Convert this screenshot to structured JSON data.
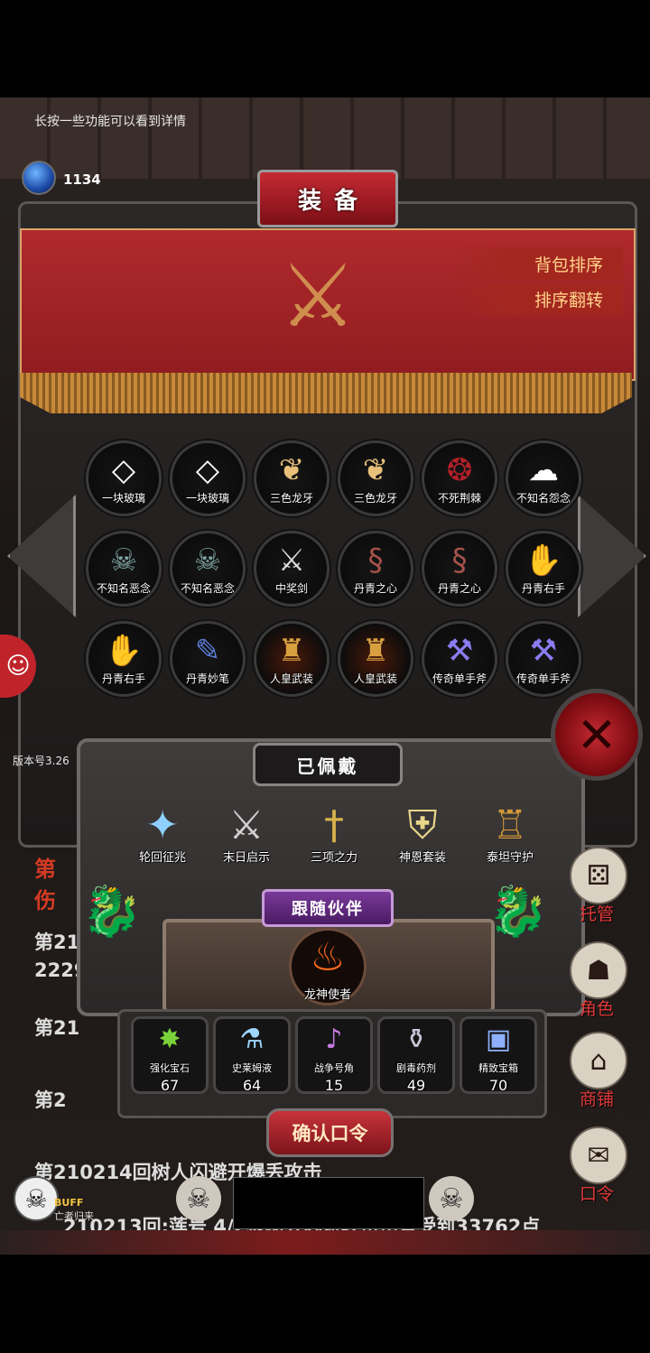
{
  "hint": "长按一些功能可以看到详情",
  "currency": {
    "icon": "gem-icon",
    "label": "宝石",
    "value": "1134"
  },
  "panel": {
    "title": "装备",
    "sort_bag": "背包排序",
    "sort_reverse": "排序翻转"
  },
  "inventory": [
    {
      "label": "一块玻璃",
      "icon": "glass-shard-icon"
    },
    {
      "label": "一块玻璃",
      "icon": "glass-shard-icon"
    },
    {
      "label": "三色龙牙",
      "icon": "dragon-fang-icon"
    },
    {
      "label": "三色龙牙",
      "icon": "dragon-fang-icon"
    },
    {
      "label": "不死荆棘",
      "icon": "thorn-ring-icon"
    },
    {
      "label": "不知名怨念",
      "icon": "ghost-icon"
    },
    {
      "label": "不知名恶念",
      "icon": "wraith-icon"
    },
    {
      "label": "不知名恶念",
      "icon": "wraith-icon"
    },
    {
      "label": "中奖剑",
      "icon": "sword-icon"
    },
    {
      "label": "丹青之心",
      "icon": "serpent-heart-icon"
    },
    {
      "label": "丹青之心",
      "icon": "serpent-heart-icon"
    },
    {
      "label": "丹青右手",
      "icon": "glove-icon"
    },
    {
      "label": "丹青右手",
      "icon": "glove-icon"
    },
    {
      "label": "丹青妙笔",
      "icon": "brush-icon"
    },
    {
      "label": "人皇武装",
      "icon": "armor-knight-icon"
    },
    {
      "label": "人皇武装",
      "icon": "armor-knight-icon"
    },
    {
      "label": "传奇单手斧",
      "icon": "axe-icon"
    },
    {
      "label": "传奇单手斧",
      "icon": "axe-icon"
    }
  ],
  "equipped": {
    "title": "已佩戴",
    "items": [
      {
        "label": "轮回征兆",
        "icon": "crystal-icon"
      },
      {
        "label": "末日启示",
        "icon": "crossed-weapons-icon"
      },
      {
        "label": "三项之力",
        "icon": "triple-sword-icon"
      },
      {
        "label": "神恩套装",
        "icon": "holy-armor-icon"
      },
      {
        "label": "泰坦守护",
        "icon": "titan-armor-icon"
      }
    ]
  },
  "companion": {
    "title": "跟随伙伴",
    "label": "龙神使者",
    "icon": "fire-dragon-icon"
  },
  "consumables": [
    {
      "label": "强化宝石",
      "count": "67",
      "icon": "green-gem-icon"
    },
    {
      "label": "史莱姆液",
      "count": "64",
      "icon": "potion-bottle-icon"
    },
    {
      "label": "战争号角",
      "count": "15",
      "icon": "war-horn-icon"
    },
    {
      "label": "剧毒药剂",
      "count": "49",
      "icon": "poison-flask-icon"
    },
    {
      "label": "精致宝箱",
      "count": "70",
      "icon": "treasure-chest-icon"
    }
  ],
  "confirm_label": "确认口令",
  "version": "版本号3.26",
  "background_log": {
    "line1": "第",
    "line2": "伤",
    "line3": "第21",
    "line4": "2229",
    "line5": "第21",
    "line6": "第2",
    "line7": "第210214回树人闪避开爆丢攻击",
    "line8": "210213回:莲号 4/2被树人闪避攻击伤害受到33762点"
  },
  "side_menu": [
    {
      "label": "托管",
      "icon": "dice-icon"
    },
    {
      "label": "角色",
      "icon": "hooded-figure-icon"
    },
    {
      "label": "商铺",
      "icon": "shop-icon"
    },
    {
      "label": "口令",
      "icon": "scroll-icon"
    }
  ],
  "buff": {
    "label": "BUFF",
    "sub": "亡者归来"
  }
}
